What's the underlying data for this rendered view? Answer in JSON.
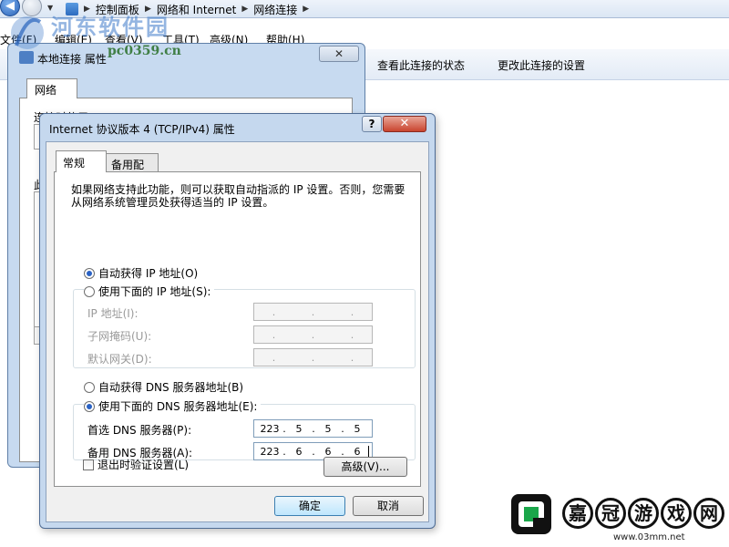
{
  "explorer": {
    "breadcrumbs": [
      "控制面板",
      "网络和 Internet",
      "网络连接"
    ],
    "menu": {
      "file": "文件(F)",
      "edit": "编辑(E)",
      "view": "查看(V)",
      "tools": "工具(T)",
      "advanced": "高级(N)",
      "help": "帮助(H)"
    },
    "commands": {
      "view_status": "查看此连接的状态",
      "change_settings": "更改此连接的设置"
    }
  },
  "watermark": {
    "site_name": "河东软件园",
    "site_url": "pc0359.cn"
  },
  "local_window": {
    "title": "本地连接 属性",
    "close_glyph": "✕",
    "tab": "网络",
    "label_connect_using": "连接时使用:",
    "label_items_prefix": "此"
  },
  "dialog": {
    "title": "Internet 协议版本 4 (TCP/IPv4) 属性",
    "help_glyph": "?",
    "close_glyph": "✕",
    "tabs": {
      "general": "常规",
      "alternate": "备用配置"
    },
    "description": "如果网络支持此功能，则可以获取自动指派的 IP 设置。否则，您需要从网络系统管理员处获得适当的 IP 设置。",
    "ip_auto": "自动获得 IP 地址(O)",
    "ip_manual": "使用下面的 IP 地址(S):",
    "ip_address_label": "IP 地址(I):",
    "subnet_label": "子网掩码(U):",
    "gateway_label": "默认网关(D):",
    "dns_auto": "自动获得 DNS 服务器地址(B)",
    "dns_manual": "使用下面的 DNS 服务器地址(E):",
    "preferred_dns_label": "首选 DNS 服务器(P):",
    "alternate_dns_label": "备用 DNS 服务器(A):",
    "preferred_dns": [
      "223",
      "5",
      "5",
      "5"
    ],
    "alternate_dns": [
      "223",
      "6",
      "6",
      "6"
    ],
    "ip_selection": "auto",
    "dns_selection": "manual",
    "validate_on_exit": "退出时验证设置(L)",
    "validate_checked": false,
    "advanced_button": "高级(V)...",
    "ok_button": "确定",
    "cancel_button": "取消"
  },
  "brand": {
    "chars": [
      "嘉",
      "冠",
      "游",
      "戏",
      "网"
    ],
    "url": "www.03mm.net"
  }
}
